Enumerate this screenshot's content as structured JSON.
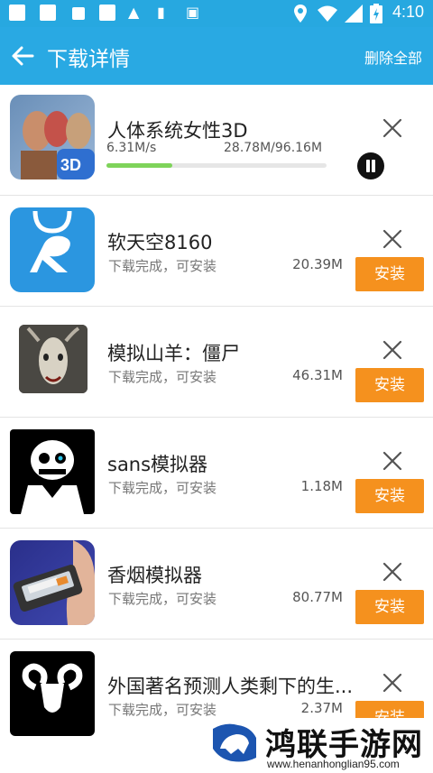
{
  "status_bar": {
    "time": "4:10"
  },
  "app_bar": {
    "title": "下载详情",
    "delete_all": "删除全部"
  },
  "downloading": {
    "name": "人体系统女性3D",
    "speed": "6.31M/s",
    "progress_text": "28.78M/96.16M",
    "progress_fraction": 0.3
  },
  "items": [
    {
      "name": "软天空8160",
      "status": "下载完成，可安装",
      "size": "20.39M",
      "action": "安装"
    },
    {
      "name": "模拟山羊：僵尸",
      "status": "下载完成，可安装",
      "size": "46.31M",
      "action": "安装"
    },
    {
      "name": "sans模拟器",
      "status": "下载完成，可安装",
      "size": "1.18M",
      "action": "安装"
    },
    {
      "name": "香烟模拟器",
      "status": "下载完成，可安装",
      "size": "80.77M",
      "action": "安装"
    },
    {
      "name": "外国著名预测人类剩下的生...",
      "status": "下载完成，可安装",
      "size": "2.37M",
      "action": "安装"
    }
  ],
  "watermark": {
    "name": "鸿联手游网",
    "url": "www.henanhonglian95.com"
  },
  "colors": {
    "primary": "#29a9e3",
    "install": "#f5911e",
    "progress": "#7ed35a"
  }
}
